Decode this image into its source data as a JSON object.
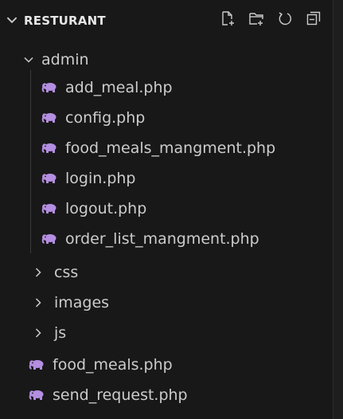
{
  "explorer": {
    "project_title": "RESTURANT",
    "toolbar": {
      "new_file_icon": "new-file-icon",
      "new_folder_icon": "new-folder-icon",
      "refresh_icon": "refresh-icon",
      "collapse_icon": "collapse-all-icon"
    },
    "admin_folder": {
      "label": "admin",
      "files": [
        "add_meal.php",
        "config.php",
        "food_meals_mangment.php",
        "login.php",
        "logout.php",
        "order_list_mangment.php"
      ]
    },
    "folders": [
      "css",
      "images",
      "js"
    ],
    "root_files": [
      "food_meals.php",
      "send_request.php"
    ],
    "colors": {
      "php_icon": "#b48ee0",
      "background": "#181818",
      "text": "#cccccc"
    }
  }
}
